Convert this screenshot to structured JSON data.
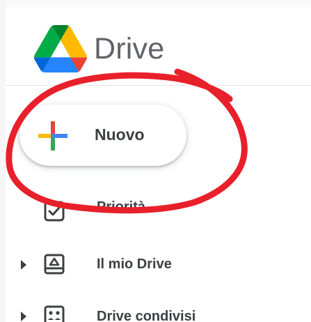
{
  "app": {
    "title": "Drive",
    "logo_icon": "google-drive-logo"
  },
  "new_button": {
    "label": "Nuovo",
    "icon": "plus-icon",
    "icon_colors": [
      "#ea4335",
      "#fbbc04",
      "#34a853",
      "#4285f4"
    ]
  },
  "nav": {
    "items": [
      {
        "label": "Priorità",
        "icon": "checkbox-icon",
        "has_expander": false
      },
      {
        "label": "Il mio Drive",
        "icon": "my-drive-icon",
        "has_expander": true
      },
      {
        "label": "Drive condivisi",
        "icon": "shared-drives-icon",
        "has_expander": true
      }
    ]
  },
  "annotation": {
    "shape": "freehand-circle",
    "color": "#e8202a"
  },
  "colors": {
    "text": "#3c4043",
    "title": "#5f6368",
    "divider": "#e2e2e2"
  }
}
